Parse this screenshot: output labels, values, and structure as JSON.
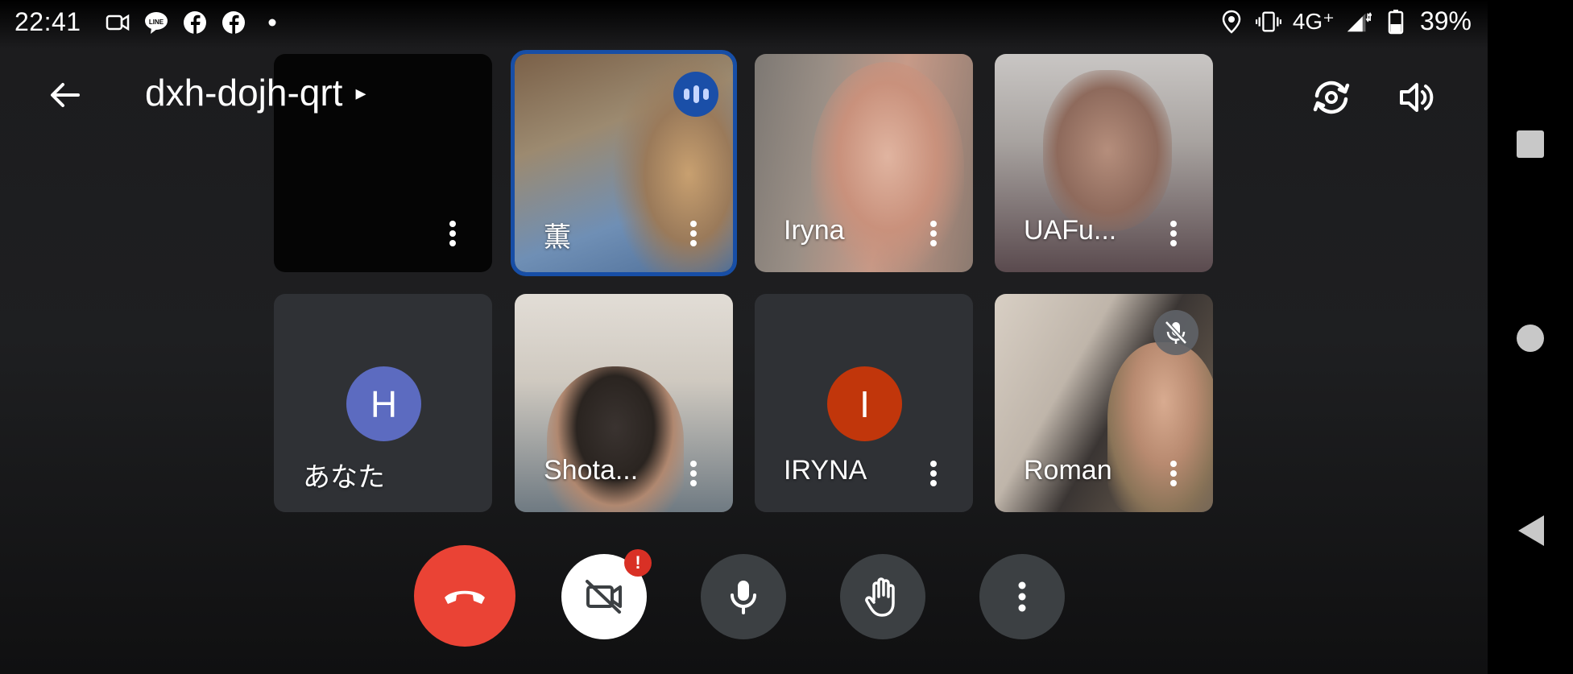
{
  "status_bar": {
    "time": "22:41",
    "network": "4G⁺",
    "battery": "39%",
    "left_icons": [
      "video-camera-icon",
      "line-app-icon",
      "facebook-icon",
      "facebook-icon",
      "dot-icon"
    ],
    "right_icons": [
      "location-icon",
      "vibrate-icon",
      "signal-icon",
      "battery-icon"
    ]
  },
  "header": {
    "meeting_code": "dxh-dojh-qrt",
    "caret": "▸"
  },
  "participants": [
    {
      "name": "",
      "type": "video",
      "speaking": false,
      "muted": false
    },
    {
      "name": "薫",
      "type": "video",
      "speaking": true,
      "muted": false
    },
    {
      "name": "Iryna",
      "type": "video",
      "speaking": false,
      "muted": false
    },
    {
      "name": "UAFu...",
      "type": "video",
      "speaking": false,
      "muted": false
    },
    {
      "name": "あなた",
      "type": "avatar",
      "initial": "H",
      "avatar_color": "#5c6bc0",
      "speaking": false,
      "muted": false
    },
    {
      "name": "Shota...",
      "type": "video",
      "speaking": false,
      "muted": false
    },
    {
      "name": "IRYNA",
      "type": "avatar",
      "initial": "I",
      "avatar_color": "#c1360b",
      "speaking": false,
      "muted": false
    },
    {
      "name": "Roman",
      "type": "video",
      "speaking": false,
      "muted": true
    }
  ],
  "controls": {
    "end_call": "end-call-icon",
    "camera": "camera-off-icon",
    "camera_warning": "!",
    "mic": "microphone-icon",
    "hand": "raise-hand-icon",
    "more": "more-vert-icon"
  },
  "colors": {
    "end_call": "#ea4335",
    "active_speaker_border": "#174ea6",
    "warning": "#d93025"
  }
}
